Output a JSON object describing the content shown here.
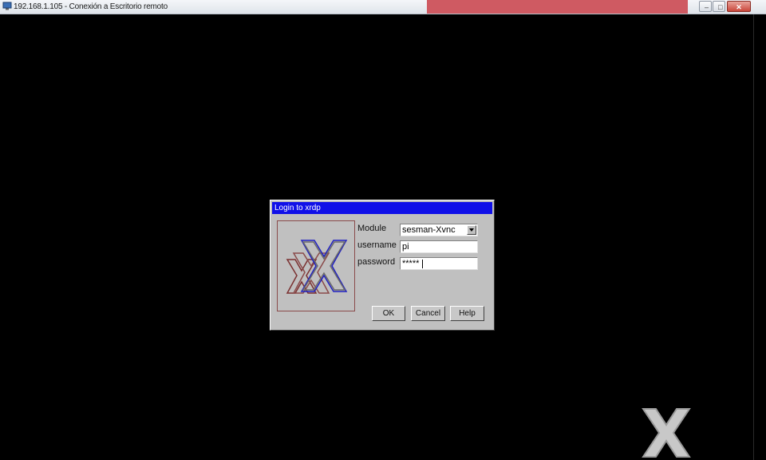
{
  "window": {
    "title": "192.168.1.105 - Conexión a Escritorio remoto",
    "controls": {
      "minimize": "–",
      "maximize": "□",
      "close": "✕"
    }
  },
  "dialog": {
    "title": "Login to xrdp",
    "module_label": "Module",
    "module_value": "sesman-Xvnc",
    "username_label": "username",
    "username_value": "pi",
    "password_label": "password",
    "password_value": "*****",
    "ok_label": "OK",
    "cancel_label": "Cancel",
    "help_label": "Help"
  },
  "colors": {
    "desktop_bg": "#000000",
    "dialog_bg": "#c0c0c0",
    "dialog_titlebar": "#1010e8"
  },
  "icons": [
    "remote-desktop-icon",
    "xrdp-logo-icon",
    "dropdown-arrow-icon"
  ]
}
